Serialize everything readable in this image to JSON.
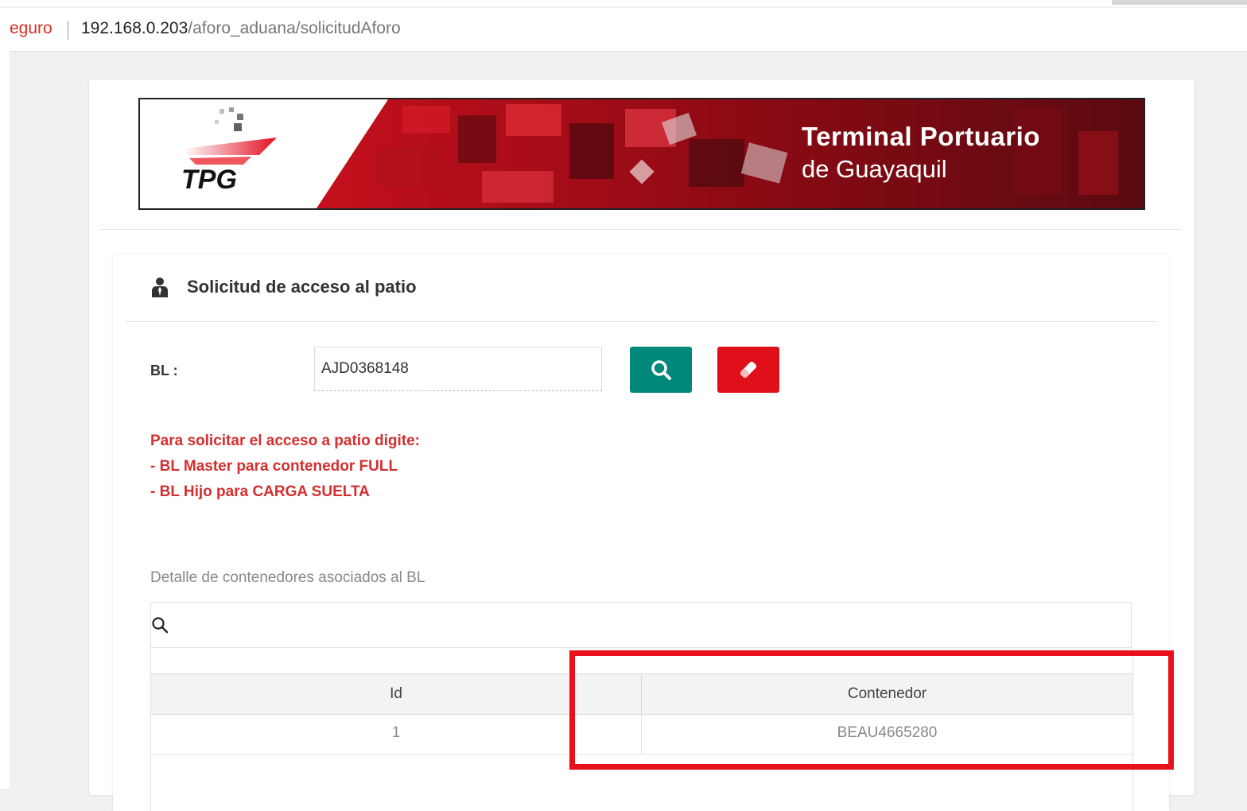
{
  "browser": {
    "secure_label": "eguro",
    "url_host": "192.168.0.203",
    "url_path": "/aforo_aduana/solicitudAforo"
  },
  "banner": {
    "logo_text": "TPG",
    "title": "Terminal Portuario",
    "subtitle": "de Guayaquil"
  },
  "panel": {
    "title": "Solicitud de acceso al patio",
    "icon": "user-tie-icon"
  },
  "form": {
    "bl_label": "BL :",
    "bl_value": "AJD0368148",
    "search_icon": "search-icon",
    "clear_icon": "eraser-icon"
  },
  "instructions": {
    "line1": "Para solicitar el acceso a patio digite:",
    "line2": "- BL Master para contenedor FULL",
    "line3": "- BL Hijo para CARGA SUELTA"
  },
  "details": {
    "label": "Detalle de contenedores asociados al BL",
    "filter_icon": "search-icon",
    "columns": [
      "Id",
      "Contenedor"
    ],
    "rows": [
      {
        "id": "1",
        "container": "BEAU4665280"
      }
    ]
  },
  "colors": {
    "accent_search": "#00897b",
    "accent_clear": "#e0101a",
    "instruction_text": "#d32f2f",
    "highlight": "#e8101a"
  }
}
